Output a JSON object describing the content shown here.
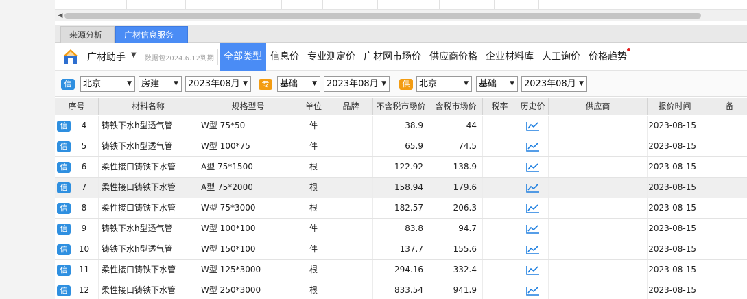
{
  "tabs": {
    "source_analysis": "来源分析",
    "info_service": "广材信息服务"
  },
  "toolbar": {
    "assistant_label": "广材助手",
    "data_version": "数据包2024.6.12到期",
    "nav": [
      {
        "label": "全部类型",
        "active": true
      },
      {
        "label": "信息价"
      },
      {
        "label": "专业测定价"
      },
      {
        "label": "广材网市场价"
      },
      {
        "label": "供应商价格"
      },
      {
        "label": "企业材料库"
      },
      {
        "label": "人工询价"
      },
      {
        "label": "价格趋势",
        "notify_dot": true
      }
    ]
  },
  "filters": {
    "badge_info": "信",
    "badge_pro": "专",
    "badge_supplier": "供",
    "info_city": "北京",
    "info_category": "房建",
    "info_month": "2023年08月",
    "pro_category": "基础",
    "pro_month": "2023年08月",
    "sup_city": "北京",
    "sup_category": "基础",
    "sup_month": "2023年08月"
  },
  "table": {
    "headers": [
      "序号",
      "材料名称",
      "规格型号",
      "单位",
      "品牌",
      "不含税市场价",
      "含税市场价",
      "税率",
      "历史价",
      "供应商",
      "报价时间",
      "备"
    ],
    "badge": "信",
    "rows": [
      {
        "no": "4",
        "name": "铸铁下水h型透气管",
        "spec": "W型 75*50",
        "unit": "件",
        "brand": "",
        "price_ex": "38.9",
        "price_in": "44",
        "tax": "",
        "supplier": "",
        "date": "2023-08-15"
      },
      {
        "no": "5",
        "name": "铸铁下水h型透气管",
        "spec": "W型 100*75",
        "unit": "件",
        "brand": "",
        "price_ex": "65.9",
        "price_in": "74.5",
        "tax": "",
        "supplier": "",
        "date": "2023-08-15"
      },
      {
        "no": "6",
        "name": "柔性接口铸铁下水管",
        "spec": "A型 75*1500",
        "unit": "根",
        "brand": "",
        "price_ex": "122.92",
        "price_in": "138.9",
        "tax": "",
        "supplier": "",
        "date": "2023-08-15"
      },
      {
        "no": "7",
        "name": "柔性接口铸铁下水管",
        "spec": "A型 75*2000",
        "unit": "根",
        "brand": "",
        "price_ex": "158.94",
        "price_in": "179.6",
        "tax": "",
        "supplier": "",
        "date": "2023-08-15",
        "highlight": true
      },
      {
        "no": "8",
        "name": "柔性接口铸铁下水管",
        "spec": "W型 75*3000",
        "unit": "根",
        "brand": "",
        "price_ex": "182.57",
        "price_in": "206.3",
        "tax": "",
        "supplier": "",
        "date": "2023-08-15"
      },
      {
        "no": "9",
        "name": "铸铁下水h型透气管",
        "spec": "W型 100*100",
        "unit": "件",
        "brand": "",
        "price_ex": "83.8",
        "price_in": "94.7",
        "tax": "",
        "supplier": "",
        "date": "2023-08-15"
      },
      {
        "no": "10",
        "name": "铸铁下水h型透气管",
        "spec": "W型 150*100",
        "unit": "件",
        "brand": "",
        "price_ex": "137.7",
        "price_in": "155.6",
        "tax": "",
        "supplier": "",
        "date": "2023-08-15"
      },
      {
        "no": "11",
        "name": "柔性接口铸铁下水管",
        "spec": "W型 125*3000",
        "unit": "根",
        "brand": "",
        "price_ex": "294.16",
        "price_in": "332.4",
        "tax": "",
        "supplier": "",
        "date": "2023-08-15"
      },
      {
        "no": "12",
        "name": "柔性接口铸铁下水管",
        "spec": "W型 250*3000",
        "unit": "根",
        "brand": "",
        "price_ex": "833.54",
        "price_in": "941.9",
        "tax": "",
        "supplier": "",
        "date": "2023-08-15"
      }
    ]
  },
  "colors": {
    "accent": "#4a8cf5",
    "badge": "#2e8fe0",
    "pro_badge": "#f39c12",
    "notify": "#e02020",
    "trend_icon": "#1e7fe0"
  },
  "icons": {
    "history": "trend-chart-icon",
    "logo": "app-logo-icon"
  }
}
